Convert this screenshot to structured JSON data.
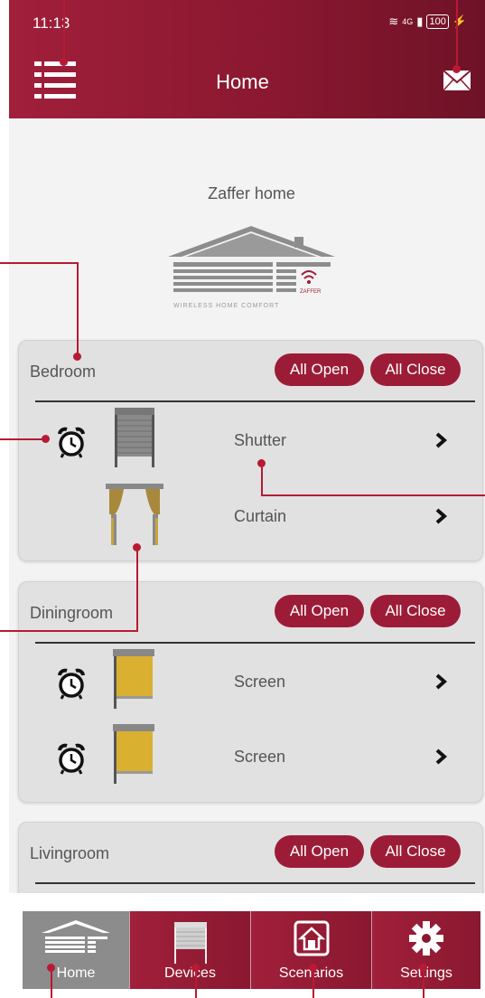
{
  "status": {
    "time": "11:13",
    "signal": "4G",
    "battery": "100"
  },
  "header": {
    "title": "Home"
  },
  "home": {
    "name": "Zaffer home",
    "logo_tagline": "WIRELESS HOME COMFORT",
    "logo_brand": "ZAFFER"
  },
  "rooms": [
    {
      "name": "Bedroom",
      "all_open": "All Open",
      "all_close": "All Close",
      "devices": [
        {
          "name": "Shutter",
          "alarm": true
        },
        {
          "name": "Curtain",
          "alarm": false
        }
      ]
    },
    {
      "name": "Diningroom",
      "all_open": "All Open",
      "all_close": "All Close",
      "devices": [
        {
          "name": "Screen",
          "alarm": true
        },
        {
          "name": "Screen",
          "alarm": true
        }
      ]
    },
    {
      "name": "Livingroom",
      "all_open": "All Open",
      "all_close": "All Close",
      "devices": []
    }
  ],
  "nav": {
    "home": "Home",
    "devices": "Devices",
    "scenarios": "Scenarios",
    "settings": "Settings"
  },
  "colors": {
    "brand": "#9c1c38",
    "annotation": "#b81a33",
    "active_tab": "#8c8c8c"
  }
}
